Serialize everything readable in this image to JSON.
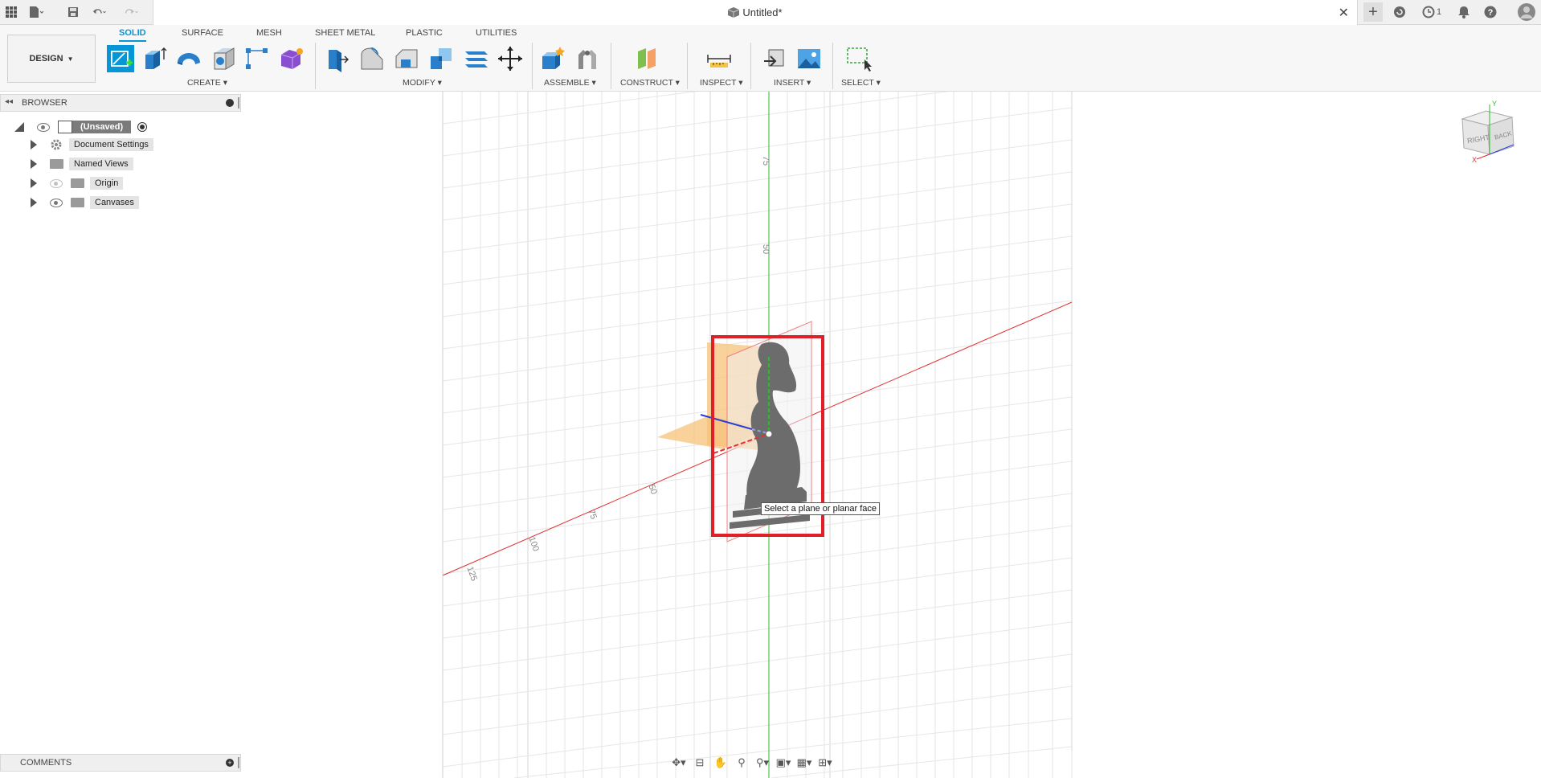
{
  "app": {
    "title": "Untitled*"
  },
  "ribbon": {
    "workspace_label": "DESIGN",
    "tabs": [
      "SOLID",
      "SURFACE",
      "MESH",
      "SHEET METAL",
      "PLASTIC",
      "UTILITIES"
    ],
    "groups": [
      "CREATE",
      "MODIFY",
      "ASSEMBLE",
      "CONSTRUCT",
      "INSPECT",
      "INSERT",
      "SELECT"
    ]
  },
  "topbar": {
    "job_count": "1"
  },
  "browser": {
    "title": "BROWSER",
    "root_label": "(Unsaved)",
    "items": [
      {
        "label": "Document Settings",
        "icon": "gear-icon"
      },
      {
        "label": "Named Views",
        "icon": "folder-icon"
      },
      {
        "label": "Origin",
        "icon": "folder-icon"
      },
      {
        "label": "Canvases",
        "icon": "folder-icon"
      }
    ]
  },
  "comments": {
    "title": "COMMENTS"
  },
  "viewport": {
    "tooltip": "Select a plane or planar face",
    "axis_ticks_vertical": [
      "75",
      "50"
    ],
    "axis_ticks_horizontal": [
      "50",
      "75",
      "100",
      "125"
    ],
    "viewcube_faces": [
      "RIGHT",
      "BACK"
    ],
    "viewcube_axes": [
      "Y",
      "X"
    ]
  },
  "colors": {
    "accent": "#0696d7",
    "highlight_box": "#e01f26",
    "x_axis": "#e03030",
    "y_axis": "#2bbb2b",
    "z_axis": "#2a3fd8",
    "plane": "#f5c27a"
  }
}
